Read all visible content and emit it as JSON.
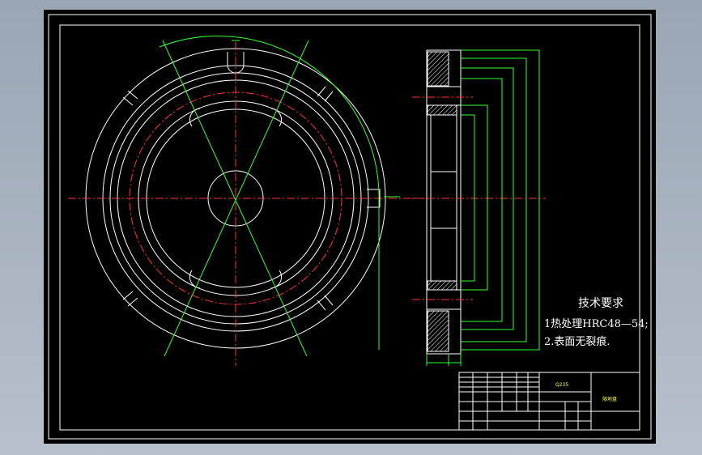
{
  "drawing": {
    "background": "#000000",
    "line_color": "#ffffff",
    "centerline_color": "#ff3333",
    "dimension_color": "#33ff33",
    "cursor_color": "#ffff33"
  },
  "technical_requirements": {
    "title": "技术要求",
    "items": [
      "1热处理HRC48—54;",
      "2.表面无裂痕."
    ]
  },
  "title_block": {
    "material": "Q235",
    "part_name": "限地盘"
  }
}
